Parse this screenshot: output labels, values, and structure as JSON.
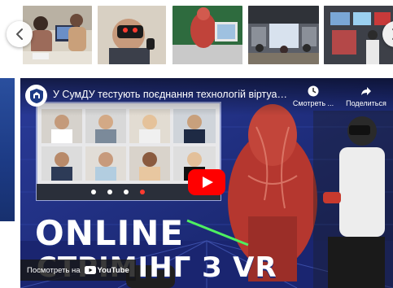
{
  "gallery": {
    "prev_icon": "chevron-left-icon",
    "next_icon": "chevron-right-icon",
    "thumbnails": [
      {
        "subject": "students-at-laptop"
      },
      {
        "subject": "vr-headset-user"
      },
      {
        "subject": "anatomy-3d-model"
      },
      {
        "subject": "vr-lab-room"
      },
      {
        "subject": "vr-demo-screens"
      }
    ]
  },
  "video": {
    "title": "У СумДУ тестують поєднання технологій віртуальної ре...",
    "watch_later_label": "Смотреть ...",
    "share_label": "Поделиться",
    "overlay_line1": "ONLINE",
    "overlay_line2": "СТРІМІНГ З VR",
    "watch_on_label": "Посмотреть на",
    "platform_name": "YouTube",
    "colors": {
      "play_button": "#ff0000",
      "overlay_text": "#ffffff",
      "background": "#1a2a7a"
    }
  }
}
